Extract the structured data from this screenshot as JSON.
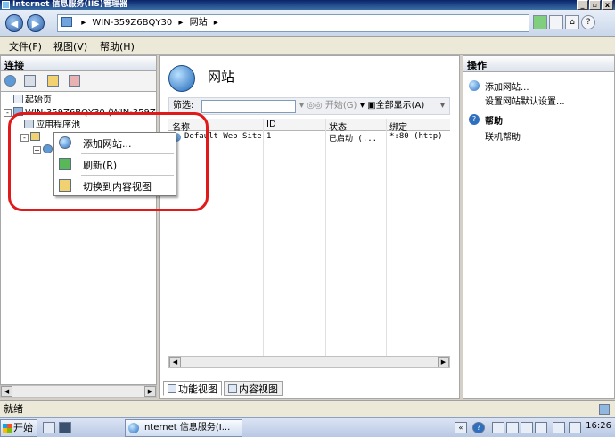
{
  "window": {
    "title": "Internet 信息服务(IIS)管理器",
    "min_glyph": "_",
    "max_glyph": "▫",
    "close_glyph": "x"
  },
  "address": {
    "server": "WIN-359Z6BQY30",
    "section": "网站",
    "separator": "▸"
  },
  "menu": {
    "file": "文件(F)",
    "view": "视图(V)",
    "help": "帮助(H)"
  },
  "connections": {
    "header": "连接",
    "tree": {
      "start_page": "起始页",
      "server_node": "WIN-359Z6BQY30 (WIN-359Z6",
      "app_pools": "应用程序池",
      "expand_plus": "+",
      "collapse_minus": "-"
    }
  },
  "context_menu": {
    "add_site": "添加网站...",
    "refresh": "刷新(R)",
    "switch_content": "切换到内容视图"
  },
  "center": {
    "title": "网站",
    "filter_label": "筛选:",
    "start_label": "开始(G)",
    "show_all_label": "全部显示(A)",
    "columns": {
      "name": "名称",
      "id": "ID",
      "status": "状态",
      "binding": "绑定"
    },
    "rows": [
      {
        "name": "Default Web Site",
        "id": "1",
        "status": "已启动 (...",
        "binding": "*:80 (http)"
      }
    ],
    "tab_features": "功能视图",
    "tab_content": "内容视图"
  },
  "actions": {
    "header": "操作",
    "add_site": "添加网站...",
    "set_defaults": "设置网站默认设置...",
    "help_group": "帮助",
    "online_help": "联机帮助"
  },
  "status_text": "就绪",
  "taskbar": {
    "start": "开始",
    "window_label": "Internet 信息服务(I...",
    "clock": "16:26"
  }
}
